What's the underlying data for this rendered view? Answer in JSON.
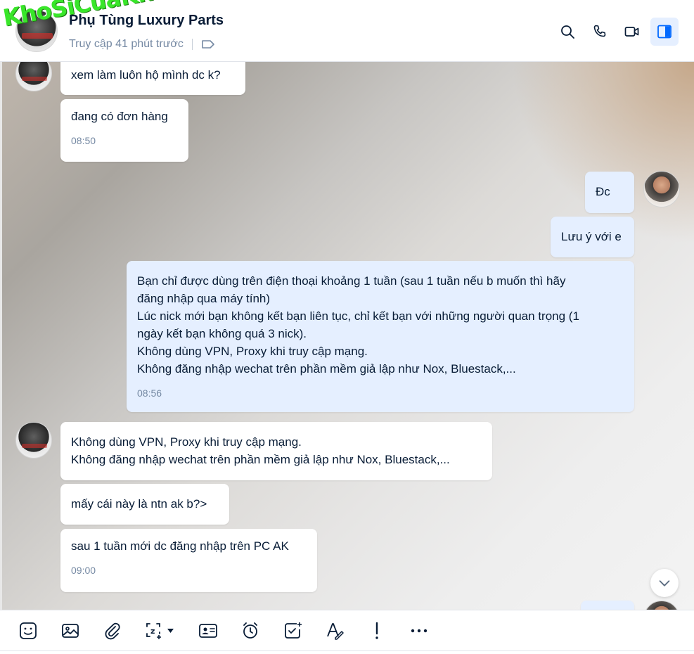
{
  "header": {
    "title": "Phụ Tùng Luxury Parts",
    "status": "Truy cập 41 phút trước",
    "watermark": "KhoSiCuaKhau.Com",
    "actions": [
      {
        "name": "search-icon"
      },
      {
        "name": "phone-icon"
      },
      {
        "name": "video-icon"
      },
      {
        "name": "sidebar-toggle-icon"
      }
    ]
  },
  "messages": {
    "m1": {
      "text": "xem làm luôn hộ mình dc k?"
    },
    "m2": {
      "text": "đang có đơn hàng",
      "time": "08:50"
    },
    "m3": {
      "text": "Đc"
    },
    "m4": {
      "text": "Lưu ý với e"
    },
    "m5": {
      "lines": [
        "Bạn chỉ được dùng trên điện thoại khoảng 1 tuần (sau 1 tuần nếu b muốn thì hãy",
        "đăng nhập qua máy tính)",
        "Lúc nick mới bạn không kết bạn liên tục, chỉ kết bạn với những người quan trọng (1",
        "ngày kết bạn không quá 3 nick).",
        "Không dùng VPN, Proxy khi truy cập mạng.",
        "Không đăng nhập wechat trên phần mềm giả lập như Nox, Bluestack,..."
      ],
      "time": "08:56"
    },
    "m6": {
      "lines": [
        "Không dùng VPN, Proxy khi truy cập mạng.",
        "Không đăng nhập wechat trên phần mềm giả lập như Nox, Bluestack,..."
      ]
    },
    "m7": {
      "text": "mấy cái này là ntn ak b?>"
    },
    "m8": {
      "text": "sau 1 tuần mới dc đăng nhập trên PC AK",
      "time": "09:00"
    }
  },
  "toolbar": {
    "tools": [
      "sticker-icon",
      "image-icon",
      "attachment-icon",
      "screenshot-icon",
      "contact-card-icon",
      "reminder-icon",
      "task-icon",
      "format-text-icon",
      "urgent-icon",
      "more-icon"
    ]
  },
  "colors": {
    "accent": "#0068ff",
    "bubble_me": "#e5efff",
    "bubble_other": "#ffffff",
    "muted_text": "#7589a3"
  }
}
